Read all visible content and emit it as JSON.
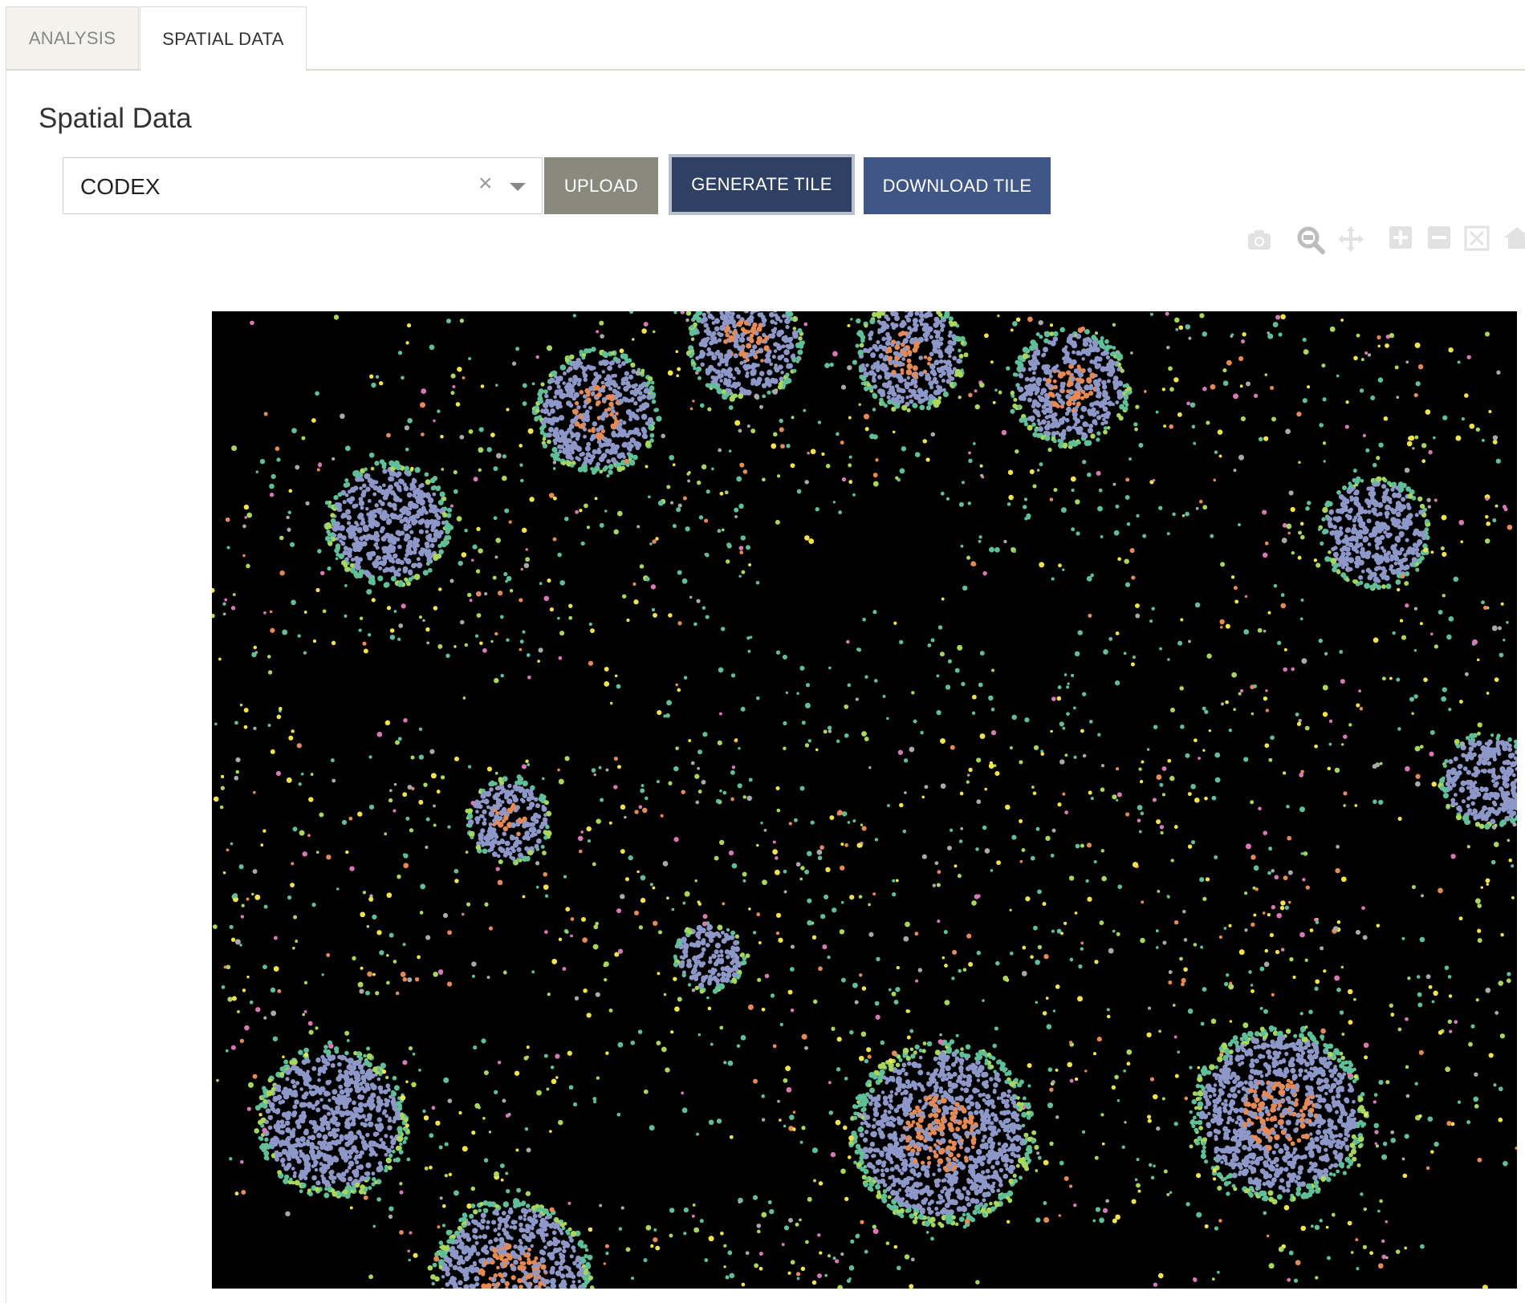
{
  "tabs": [
    {
      "label": "ANALYSIS",
      "active": false
    },
    {
      "label": "SPATIAL DATA",
      "active": true
    }
  ],
  "page": {
    "title": "Spatial Data"
  },
  "controls": {
    "dataset_select": {
      "value": "CODEX",
      "clear_glyph": "×"
    },
    "upload_label": "UPLOAD",
    "generate_tile_label": "GENERATE TILE",
    "download_tile_label": "DOWNLOAD TILE"
  },
  "modebar": {
    "icons": [
      "camera-icon",
      "zoom-icon",
      "pan-icon",
      "zoom-in-icon",
      "zoom-out-icon",
      "autoscale-icon",
      "home-icon"
    ]
  },
  "image": {
    "background": "#000000",
    "palette": {
      "b_cell_follicle": "#8e98c8",
      "germinal_center": "#e58a55",
      "teal": "#5fbf98",
      "yellow": "#f2e34a",
      "lime": "#a9d75c",
      "pink": "#d978b8",
      "grey": "#a9a9a9"
    }
  }
}
